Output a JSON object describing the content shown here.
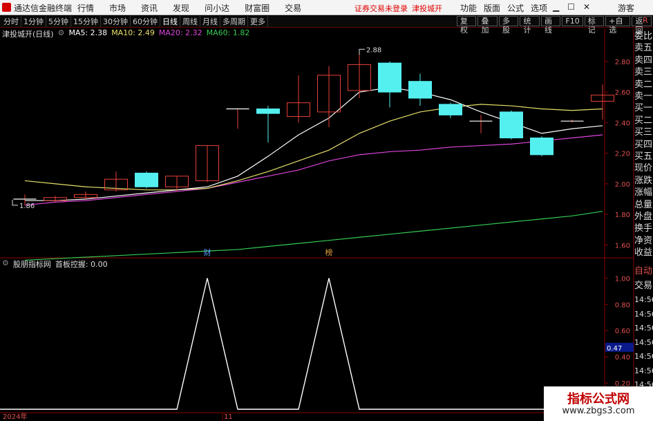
{
  "app": {
    "title": "通达信金融终端",
    "menu": [
      "行情",
      "市场",
      "资讯",
      "发现",
      "问小达",
      "财富圈",
      "交易"
    ],
    "warning": "证券交易未登录",
    "stock_name_top": "津投城开",
    "right_menu": [
      "功能",
      "版面",
      "公式",
      "选项"
    ],
    "guest": "游客"
  },
  "toolbar": {
    "periods": [
      "分时",
      "1分钟",
      "5分钟",
      "15分钟",
      "30分钟",
      "60分钟",
      "日线",
      "周线",
      "月线",
      "多周期",
      "更多"
    ],
    "active_period": "日线",
    "buttons": [
      "复权",
      "叠加",
      "多股",
      "统计",
      "画线",
      "F10",
      "标记",
      "+自选",
      "返回"
    ],
    "badge": "R"
  },
  "chart_info": {
    "title": "津投城开(日线)",
    "ma5": "MA5: 2.38",
    "ma10": "MA10: 2.49",
    "ma20": "MA20: 2.32",
    "ma60": "MA60: 1.82"
  },
  "indicator_info": {
    "name": "股朋指标网",
    "value": "首板控握: 0.00"
  },
  "markers": {
    "m1": "财",
    "m2": "榜",
    "high_label": "2.88",
    "low_label": "1.86"
  },
  "date_labels": {
    "year": "2024年",
    "month": "11"
  },
  "watermark": {
    "line1": "指标公式网",
    "line2": "www.zbgs3.com"
  },
  "sidebar_upper": [
    "委比",
    "卖五",
    "卖四",
    "卖三",
    "卖二",
    "卖一",
    "买一",
    "买二",
    "买三",
    "买四",
    "买五",
    "现价",
    "涨跌",
    "涨幅",
    "总量",
    "外盘",
    "换手",
    "净资",
    "收益"
  ],
  "sidebar_lower": [
    "自动",
    "交易",
    "14:56",
    "14:56",
    "14:56",
    "14:56",
    "14:56",
    "14:56",
    "14:56",
    "14:56"
  ],
  "colors": {
    "up": "#e8413a",
    "down": "#54f0f0",
    "ma5": "#ffffff",
    "ma10": "#e6e06a",
    "ma20": "#dd44dd",
    "ma60": "#33cc55"
  },
  "chart_data": [
    {
      "type": "candlestick",
      "title": "",
      "y_ticks": [
        1.6,
        1.8,
        2.0,
        2.2,
        2.4,
        2.6,
        2.8
      ],
      "ylim": [
        1.52,
        2.94
      ],
      "candles": [
        {
          "o": 1.9,
          "h": 1.93,
          "l": 1.86,
          "c": 1.9
        },
        {
          "o": 1.89,
          "h": 1.92,
          "l": 1.88,
          "c": 1.91
        },
        {
          "o": 1.91,
          "h": 1.95,
          "l": 1.9,
          "c": 1.93
        },
        {
          "o": 1.96,
          "h": 2.08,
          "l": 1.95,
          "c": 2.03
        },
        {
          "o": 2.07,
          "h": 2.08,
          "l": 1.97,
          "c": 1.98
        },
        {
          "o": 1.98,
          "h": 2.05,
          "l": 1.95,
          "c": 2.05
        },
        {
          "o": 2.02,
          "h": 2.25,
          "l": 2.01,
          "c": 2.25
        },
        {
          "o": 2.49,
          "h": 2.49,
          "l": 2.36,
          "c": 2.49
        },
        {
          "o": 2.49,
          "h": 2.51,
          "l": 2.27,
          "c": 2.46
        },
        {
          "o": 2.44,
          "h": 2.71,
          "l": 2.4,
          "c": 2.53
        },
        {
          "o": 2.47,
          "h": 2.77,
          "l": 2.37,
          "c": 2.71
        },
        {
          "o": 2.61,
          "h": 2.88,
          "l": 2.56,
          "c": 2.78
        },
        {
          "o": 2.79,
          "h": 2.8,
          "l": 2.5,
          "c": 2.6
        },
        {
          "o": 2.67,
          "h": 2.72,
          "l": 2.51,
          "c": 2.56
        },
        {
          "o": 2.52,
          "h": 2.53,
          "l": 2.43,
          "c": 2.45
        },
        {
          "o": 2.41,
          "h": 2.45,
          "l": 2.33,
          "c": 2.41
        },
        {
          "o": 2.47,
          "h": 2.48,
          "l": 2.29,
          "c": 2.3
        },
        {
          "o": 2.3,
          "h": 2.31,
          "l": 2.18,
          "c": 2.19
        },
        {
          "o": 2.41,
          "h": 2.42,
          "l": 2.4,
          "c": 2.41
        },
        {
          "o": 2.54,
          "h": 2.65,
          "l": 2.42,
          "c": 2.58
        }
      ],
      "ma5": [
        1.89,
        1.89,
        1.9,
        1.92,
        1.94,
        1.96,
        1.98,
        2.05,
        2.18,
        2.32,
        2.43,
        2.6,
        2.63,
        2.6,
        2.55,
        2.47,
        2.4,
        2.33,
        2.36,
        2.38
      ],
      "ma10": [
        2.02,
        2.0,
        1.98,
        1.97,
        1.96,
        1.96,
        1.97,
        2.02,
        2.08,
        2.15,
        2.22,
        2.33,
        2.41,
        2.47,
        2.5,
        2.52,
        2.51,
        2.49,
        2.48,
        2.49
      ],
      "ma20": [
        1.86,
        1.88,
        1.89,
        1.91,
        1.93,
        1.95,
        1.97,
        2.01,
        2.05,
        2.09,
        2.15,
        2.19,
        2.21,
        2.22,
        2.24,
        2.25,
        2.26,
        2.28,
        2.3,
        2.32
      ],
      "ma60": [
        1.5,
        1.51,
        1.52,
        1.53,
        1.54,
        1.55,
        1.56,
        1.57,
        1.59,
        1.61,
        1.63,
        1.65,
        1.67,
        1.69,
        1.71,
        1.73,
        1.75,
        1.77,
        1.79,
        1.82
      ]
    },
    {
      "type": "line",
      "title": "",
      "y_ticks": [
        0.2,
        0.4,
        0.6,
        0.8,
        1.0
      ],
      "ylim": [
        0,
        1.06
      ],
      "highlight_value": "0.47",
      "values": [
        0,
        0,
        0,
        0,
        0,
        0,
        1,
        0,
        0,
        0,
        1,
        0,
        0,
        0,
        0,
        0,
        0,
        0,
        0,
        0
      ]
    }
  ]
}
